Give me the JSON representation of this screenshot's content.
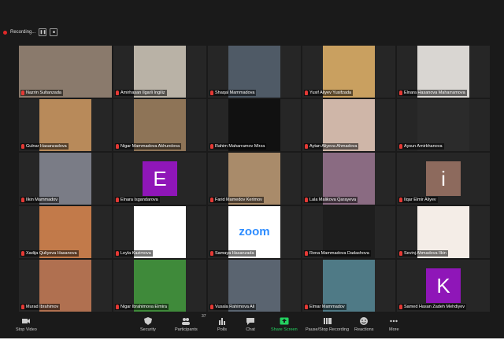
{
  "recording": {
    "label": "Recording..."
  },
  "participants": [
    {
      "name": "Nazrin Sultanzada",
      "bg": "#8a7a6c",
      "type": "photo",
      "active": true
    },
    {
      "name": "Amirhasan Ilgarli Ingiliz",
      "bg": "#b9b2a6",
      "type": "photo"
    },
    {
      "name": "Shaqal Mammadova",
      "bg": "#4f5a66",
      "type": "photo"
    },
    {
      "name": "Yusif Aliyev Yusifzada",
      "bg": "#c9a060",
      "type": "photo"
    },
    {
      "name": "Elnara Hasanova Maharramova",
      "bg": "#d9d6d2",
      "type": "photo"
    },
    {
      "name": "Gulnar Hasanzadova",
      "bg": "#b88a5a",
      "type": "photo"
    },
    {
      "name": "Nigar Mammadova Akhundova",
      "bg": "#8e7457",
      "type": "photo"
    },
    {
      "name": "Rahim Maharramov Mirza",
      "bg": "#111111",
      "type": "photo"
    },
    {
      "name": "Aytan Aliyeva Ahmadova",
      "bg": "#cfb6a8",
      "type": "photo"
    },
    {
      "name": "Aysun Amirkhanova",
      "bg": "#2b2b2b",
      "type": "photo"
    },
    {
      "name": "Ilkin Mammadov",
      "bg": "#7a7c86",
      "type": "photo"
    },
    {
      "name": "Elnara Isgandarova",
      "bg": "#8f16b8",
      "type": "letter",
      "letter": "E"
    },
    {
      "name": "Farid Mamedov Kerimov",
      "bg": "#a98b6a",
      "type": "photo"
    },
    {
      "name": "Lala Malikova Qarayeva",
      "bg": "#8a6b82",
      "type": "photo"
    },
    {
      "name": "Ilqar Elmir Aliyev",
      "bg": "#8d6a5d",
      "type": "letter",
      "letter": "i"
    },
    {
      "name": "Xadija Quliyeva Hasanova",
      "bg": "#c27a4a",
      "type": "photo"
    },
    {
      "name": "Leyla Kazimova",
      "bg": "#ffffff",
      "type": "photo"
    },
    {
      "name": "Samaya Hasanzada",
      "bg": "#ffffff",
      "type": "zoom",
      "logo": "zoom"
    },
    {
      "name": "Rena Mammadova Dadashova",
      "bg": "#1e1e1e",
      "type": "photo"
    },
    {
      "name": "Sevinj Ahmadova Ilkin",
      "bg": "#f4ede7",
      "type": "photo"
    },
    {
      "name": "Murad Ibrahimov",
      "bg": "#b07050",
      "type": "photo"
    },
    {
      "name": "Nigar Ibrahimova Elmira",
      "bg": "#3f8a3a",
      "type": "photo"
    },
    {
      "name": "Vusala Rahimova Ali",
      "bg": "#5a6470",
      "type": "photo"
    },
    {
      "name": "Elmar Mammadov",
      "bg": "#4f7a86",
      "type": "photo"
    },
    {
      "name": "Samed Hasan Zadeh Mehdiyev",
      "bg": "#8f16b8",
      "type": "letter",
      "letter": "K"
    }
  ],
  "toolbar": {
    "stop_video": "Stop Video",
    "security": "Security",
    "participants": "Participants",
    "participants_count": "37",
    "polls": "Polls",
    "chat": "Chat",
    "share_screen": "Share Screen",
    "pause_recording": "Pause/Stop Recording",
    "reactions": "Reactions",
    "more": "More",
    "green": "#23d160"
  }
}
